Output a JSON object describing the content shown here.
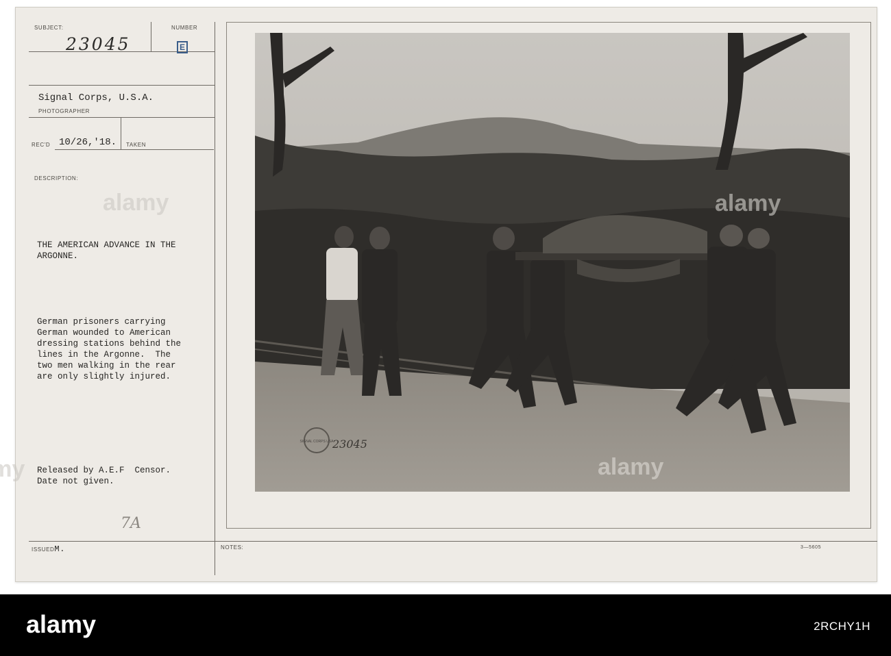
{
  "card": {
    "subject_label": "SUBJECT:",
    "number_label": "NUMBER",
    "subject_number": "23045",
    "number_stamp": "E",
    "photographer_name": "Signal Corps, U.S.A.",
    "photographer_label": "PHOTOGRAPHER",
    "recd_label": "REC'D",
    "recd_date": "10/26,'18.",
    "taken_label": "TAKEN",
    "description_label": "DESCRIPTION:",
    "title_line1": "THE AMERICAN ADVANCE IN THE",
    "title_line2": "ARGONNE.",
    "description_lines": [
      "German prisoners carrying",
      "German wounded to American",
      "dressing stations behind the",
      "lines in the Argonne.  The",
      "two men walking in the rear",
      "are only slightly injured."
    ],
    "release_line1": "Released by A.E.F  Censor.",
    "release_line2": "Date not given.",
    "margin_note": "7A",
    "issued_label": "ISSUED",
    "issued_value": "M.",
    "notes_label": "NOTES:",
    "form_code": "3—5605"
  },
  "photo": {
    "stamp_text": "SIGNAL CORPS USA",
    "stamp_number": "23045"
  },
  "watermark": {
    "text": "alamy"
  },
  "footer": {
    "logo_text": "alamy",
    "image_id": "2RCHY1H"
  }
}
